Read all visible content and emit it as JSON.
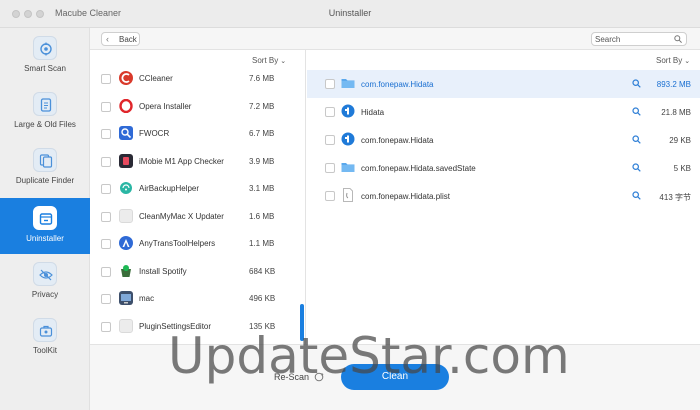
{
  "window": {
    "app_title": "Macube Cleaner",
    "title": "Uninstaller"
  },
  "sidebar": {
    "items": [
      {
        "label": "Smart Scan",
        "icon": "target-icon"
      },
      {
        "label": "Large & Old Files",
        "icon": "document-icon"
      },
      {
        "label": "Duplicate Finder",
        "icon": "copy-icon"
      },
      {
        "label": "Uninstaller",
        "icon": "uninstall-icon",
        "active": true
      },
      {
        "label": "Privacy",
        "icon": "eye-off-icon"
      },
      {
        "label": "ToolKit",
        "icon": "toolkit-icon"
      }
    ]
  },
  "nav": {
    "back_label": "Back",
    "search_placeholder": "Search"
  },
  "left": {
    "sort_label": "Sort By",
    "apps": [
      {
        "name": "CCleaner",
        "size": "7.6 MB",
        "icon": "ccleaner-icon"
      },
      {
        "name": "Opera Installer",
        "size": "7.2 MB",
        "icon": "opera-icon"
      },
      {
        "name": "FWOCR",
        "size": "6.7 MB",
        "icon": "fwocr-icon"
      },
      {
        "name": "iMobie M1 App Checker",
        "size": "3.9 MB",
        "icon": "imobie-icon"
      },
      {
        "name": "AirBackupHelper",
        "size": "3.1 MB",
        "icon": "airbackup-icon"
      },
      {
        "name": "CleanMyMac X Updater",
        "size": "1.6 MB",
        "icon": "generic-app-icon"
      },
      {
        "name": "AnyTransToolHelpers",
        "size": "1.1 MB",
        "icon": "anytrans-icon"
      },
      {
        "name": "Install Spotify",
        "size": "684 KB",
        "icon": "spotify-icon"
      },
      {
        "name": "mac",
        "size": "496 KB",
        "icon": "mac-icon"
      },
      {
        "name": "PluginSettingsEditor",
        "size": "135 KB",
        "icon": "generic-app-icon"
      }
    ]
  },
  "right": {
    "sort_label": "Sort By",
    "files": [
      {
        "name": "com.fonepaw.Hidata",
        "size": "893.2 MB",
        "icon": "folder-icon",
        "selected": true
      },
      {
        "name": "Hidata",
        "size": "21.8 MB",
        "icon": "hidata-icon"
      },
      {
        "name": "com.fonepaw.Hidata",
        "size": "29 KB",
        "icon": "hidata-icon"
      },
      {
        "name": "com.fonepaw.Hidata.savedState",
        "size": "5 KB",
        "icon": "folder-icon"
      },
      {
        "name": "com.fonepaw.Hidata.plist",
        "size": "413 字节",
        "icon": "plist-icon"
      }
    ]
  },
  "bottom": {
    "rescan_label": "Re-Scan",
    "clean_label": "Clean"
  },
  "watermark": "UpdateStar.com",
  "colors": {
    "accent": "#1a7fe0",
    "selected_row": "#e8f0fb"
  }
}
